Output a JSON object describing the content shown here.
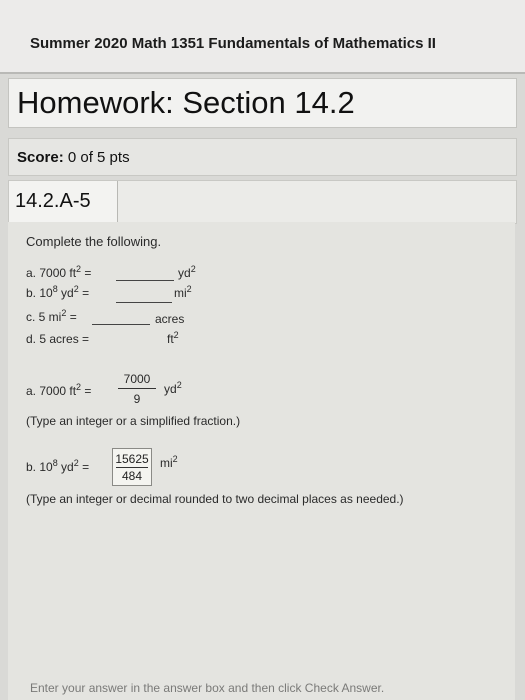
{
  "course": {
    "title": "Summer 2020 Math 1351 Fundamentals of Mathematics II"
  },
  "homework": {
    "title": "Homework: Section 14.2"
  },
  "score": {
    "label": "Score:",
    "value": "0 of 5 pts"
  },
  "question": {
    "id": "14.2.A-5"
  },
  "prompt": "Complete the following.",
  "items": [
    {
      "prefix": "a. 7000 ft",
      "exp": "2",
      "eq": " =",
      "unit": "yd",
      "unit_exp": "2"
    },
    {
      "prefix": "b. 10",
      "exp": "8",
      "mid": " yd",
      "mid_exp": "2",
      "eq": " =",
      "unit": "mi",
      "unit_exp": "2"
    },
    {
      "prefix": "c. 5 mi",
      "exp": "2",
      "eq": " =",
      "unit": "acres",
      "unit_exp": ""
    },
    {
      "prefix": "d. 5 acres =",
      "unit": "ft",
      "unit_exp": "2"
    }
  ],
  "answer_a": {
    "prefix": "a. 7000 ft",
    "exp": "2",
    "eq": " =",
    "numerator": "7000",
    "denominator": "9",
    "unit": "yd",
    "unit_exp": "2",
    "hint": "(Type an integer or a simplified fraction.)"
  },
  "answer_b": {
    "prefix": "b. 10",
    "exp": "8",
    "mid": " yd",
    "mid_exp": "2",
    "eq": " =",
    "numerator": "15625",
    "denominator": "484",
    "unit": "mi",
    "unit_exp": "2",
    "hint": "(Type an integer or decimal rounded to two decimal places as needed.)"
  },
  "footer": "Enter your answer in the answer box and then click Check Answer."
}
